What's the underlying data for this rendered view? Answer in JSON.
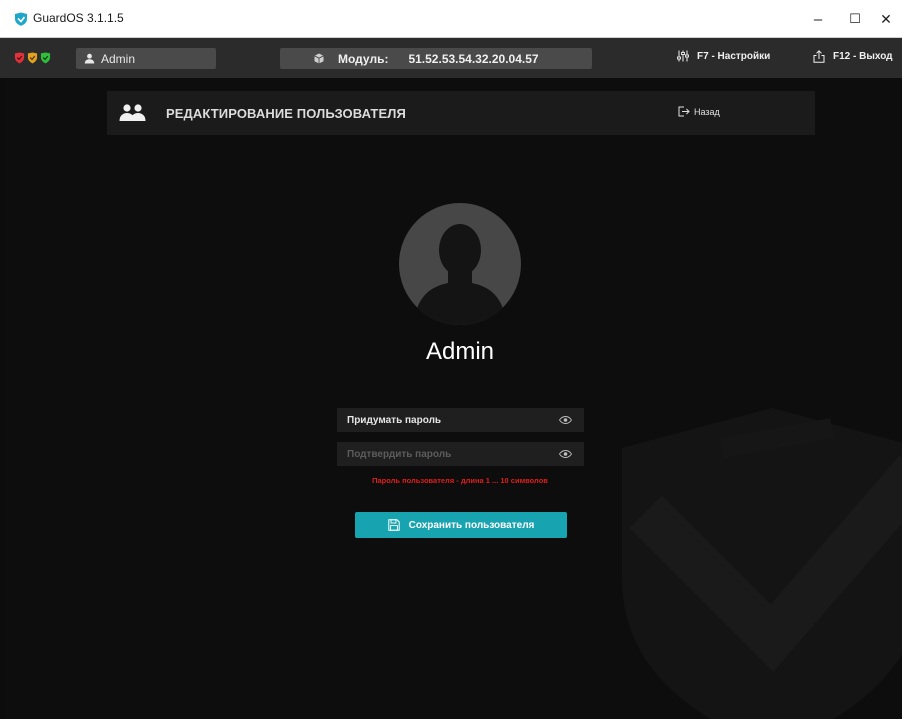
{
  "window": {
    "title": "GuardOS 3.1.1.5",
    "minimize_glyph": "–",
    "maximize_glyph": "☐",
    "close_glyph": "✕"
  },
  "topbar": {
    "status_shields": [
      {
        "icon": "shield-icon",
        "color": "#e0323a"
      },
      {
        "icon": "shield-icon",
        "color": "#e0a020"
      },
      {
        "icon": "shield-icon",
        "color": "#2fbf3a"
      }
    ],
    "user": "Admin",
    "module_label": "Модуль:",
    "module_value": "51.52.53.54.32.20.04.57",
    "settings": "F7 - Настройки",
    "exit": "F12 - Выход"
  },
  "header": {
    "title": "РЕДАКТИРОВАНИЕ ПОЛЬЗОВАТЕЛЯ",
    "back": "Назад"
  },
  "profile": {
    "username": "Admin"
  },
  "form": {
    "new_password_placeholder": "Придумать пароль",
    "confirm_password_placeholder": "Подтвердить пароль",
    "error": "Пароль пользователя - длина 1 ... 10 символов",
    "save": "Сохранить пользователя"
  },
  "colors": {
    "accent": "#17a3b0",
    "error": "#e01e1e"
  }
}
